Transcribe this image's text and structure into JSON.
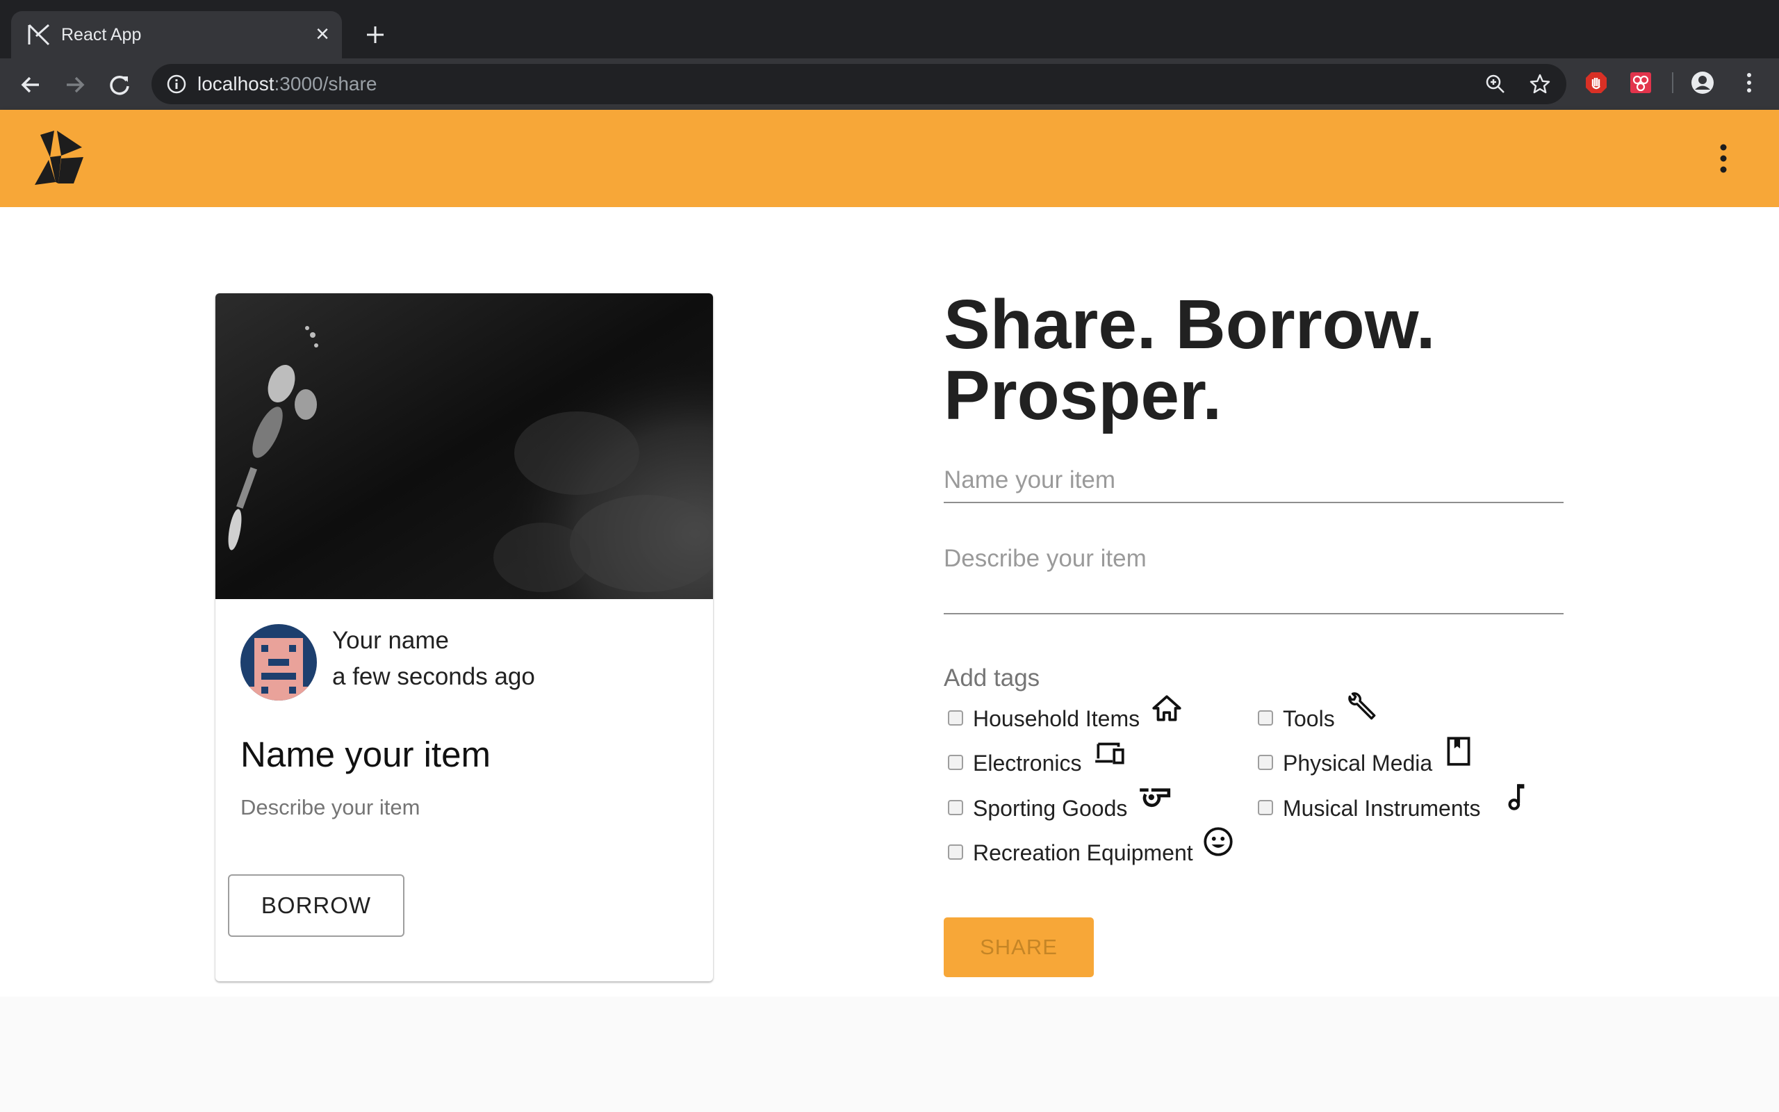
{
  "browser": {
    "tab_title": "React App",
    "tab_close": "×",
    "url_host": "localhost",
    "url_path": ":3000/share"
  },
  "card": {
    "owner_name": "Your name",
    "owner_time": "a few seconds ago",
    "title": "Name your item",
    "description": "Describe your item",
    "borrow_label": "BORROW"
  },
  "form": {
    "headline_line1": "Share. Borrow.",
    "headline_line2": "Prosper.",
    "name_placeholder": "Name your item",
    "description_placeholder": "Describe your item",
    "tags_label": "Add tags",
    "tags": [
      {
        "label": "Household Items",
        "icon": "home-icon"
      },
      {
        "label": "Tools",
        "icon": "wrench-icon"
      },
      {
        "label": "Electronics",
        "icon": "devices-icon"
      },
      {
        "label": "Physical Media",
        "icon": "book-icon"
      },
      {
        "label": "Sporting Goods",
        "icon": "whistle-icon"
      },
      {
        "label": "Musical Instruments",
        "icon": "music-note-icon"
      },
      {
        "label": "Recreation Equipment",
        "icon": "smiley-icon"
      }
    ],
    "share_label": "SHARE"
  },
  "colors": {
    "accent": "#f7a738",
    "share_text": "#c58526",
    "chrome_dark": "#202124",
    "chrome_toolbar": "#35363a"
  }
}
